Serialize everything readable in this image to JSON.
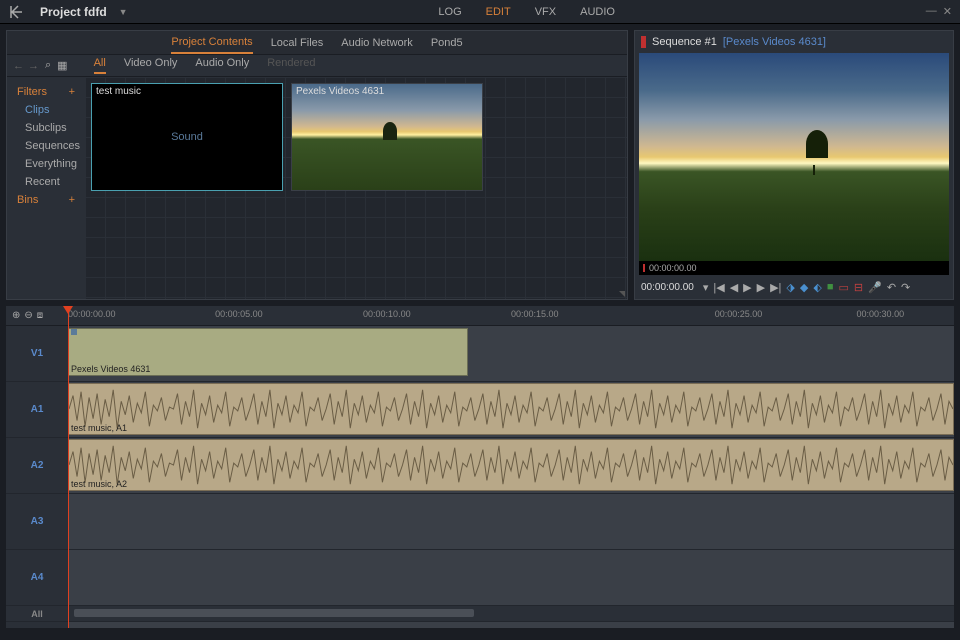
{
  "topbar": {
    "project_title": "Project fdfd",
    "tabs": [
      "LOG",
      "EDIT",
      "VFX",
      "AUDIO"
    ],
    "active_tab": "EDIT"
  },
  "media": {
    "tabs": [
      "Project Contents",
      "Local Files",
      "Audio Network",
      "Pond5"
    ],
    "active_tab": "Project Contents",
    "filter_tabs": {
      "all": "All",
      "video_only": "Video Only",
      "audio_only": "Audio Only",
      "rendered": "Rendered"
    },
    "sidebar": {
      "filters_header": "Filters",
      "clips": "Clips",
      "subclips": "Subclips",
      "sequences": "Sequences",
      "everything": "Everything",
      "recent": "Recent",
      "bins_header": "Bins"
    },
    "clips": [
      {
        "name": "test music",
        "type": "audio",
        "sound_label": "Sound"
      },
      {
        "name": "Pexels Videos 4631",
        "type": "video"
      }
    ]
  },
  "viewer": {
    "sequence_name": "Sequence #1",
    "clip_ref": "[Pexels Videos 4631]",
    "scrubber_time": "00:00:00.00",
    "timecode": "00:00:00.00"
  },
  "timeline": {
    "ticks": [
      "00:00:00.00",
      "00:00:05.00",
      "00:00:10.00",
      "00:00:15.00",
      "",
      "00:00:25.00",
      "00:00:30.00"
    ],
    "tracks": {
      "v1": "V1",
      "a1": "A1",
      "a2": "A2",
      "a3": "A3",
      "a4": "A4",
      "all": "All"
    },
    "video_clip": {
      "label": "Pexels Videos 4631"
    },
    "audio_clip_1": {
      "label": "test music, A1"
    },
    "audio_clip_2": {
      "label": "test music, A2"
    }
  }
}
